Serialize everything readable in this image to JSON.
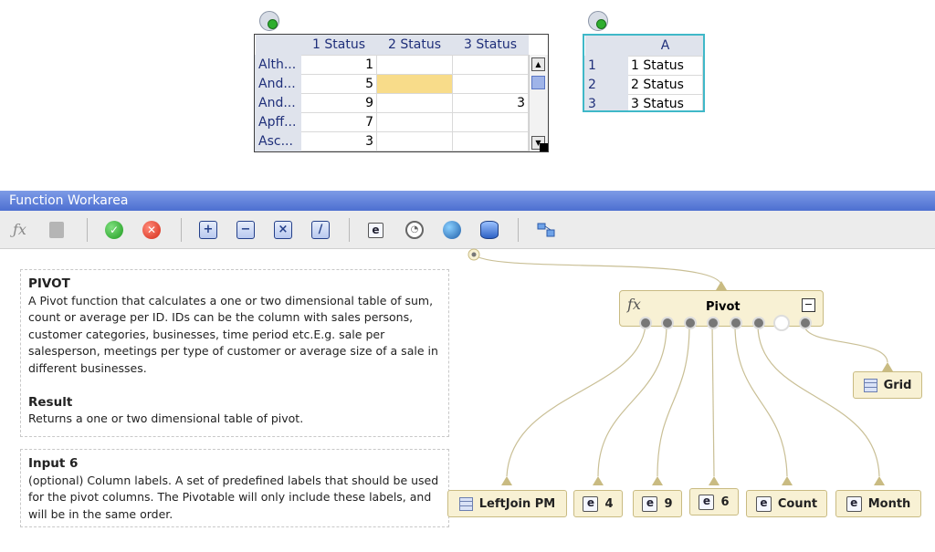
{
  "table1": {
    "columns": [
      "1 Status",
      "2 Status",
      "3 Status"
    ],
    "rows": [
      {
        "label": "Alth...",
        "c1": "1",
        "c2": "",
        "c3": ""
      },
      {
        "label": "And...",
        "c1": "5",
        "c2": "",
        "c3": ""
      },
      {
        "label": "And...",
        "c1": "9",
        "c2": "",
        "c3": "3"
      },
      {
        "label": "Apff...",
        "c1": "7",
        "c2": "",
        "c3": ""
      },
      {
        "label": "Asc...",
        "c1": "3",
        "c2": "",
        "c3": ""
      }
    ]
  },
  "table2": {
    "column": "A",
    "rows": [
      {
        "num": "1",
        "val": "1 Status"
      },
      {
        "num": "2",
        "val": "2 Status"
      },
      {
        "num": "3",
        "val": "3 Status"
      }
    ]
  },
  "workarea": {
    "title": "Function Workarea"
  },
  "description": {
    "heading": "PIVOT",
    "text": "A Pivot function that calculates a one or two dimensional table of sum, count or average per ID. IDs can be the column with sales persons, customer categories, businesses, time period etc.E.g. sale per salesperson, meetings per type of customer or average size of a sale in different businesses.",
    "result_heading": "Result",
    "result_text": "Returns a one or two dimensional table of pivot."
  },
  "input_info": {
    "heading": "Input 6",
    "text": "(optional) Column labels. A set of predefined labels that should be used for the pivot columns. The Pivotable will only include these labels, and will be in the same order."
  },
  "graph": {
    "pivot_fx": "fx",
    "pivot_label": "Pivot",
    "output_node": "Grid",
    "inputs": [
      "LeftJoin PM",
      "4",
      "9",
      "6",
      "Count",
      "Month"
    ],
    "e_icon": "e"
  },
  "colors": {
    "highlight": "#f8dc8a",
    "accent": "#3fb8c8",
    "titlebar": "#5a7bd8"
  }
}
